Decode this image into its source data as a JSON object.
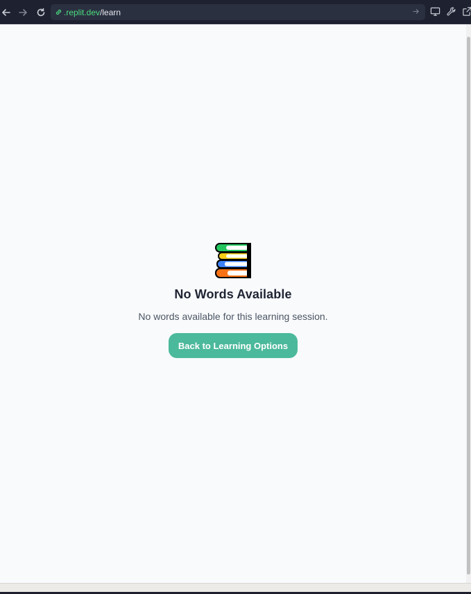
{
  "browser": {
    "url_host": ".replit.dev",
    "url_path": "/learn",
    "icons": [
      "back-arrow-icon",
      "forward-arrow-icon",
      "reload-icon",
      "link-icon",
      "go-arrow-icon",
      "monitor-icon",
      "wrench-icon",
      "open-external-icon"
    ]
  },
  "empty_state": {
    "icon": "books-icon",
    "title": "No Words Available",
    "message": "No words available for this learning session.",
    "button_label": "Back to Learning Options"
  },
  "colors": {
    "accent": "#4bb99b",
    "page_background": "#f8fafc",
    "browser_chrome": "#1e2230",
    "url_host": "#4ade80"
  }
}
